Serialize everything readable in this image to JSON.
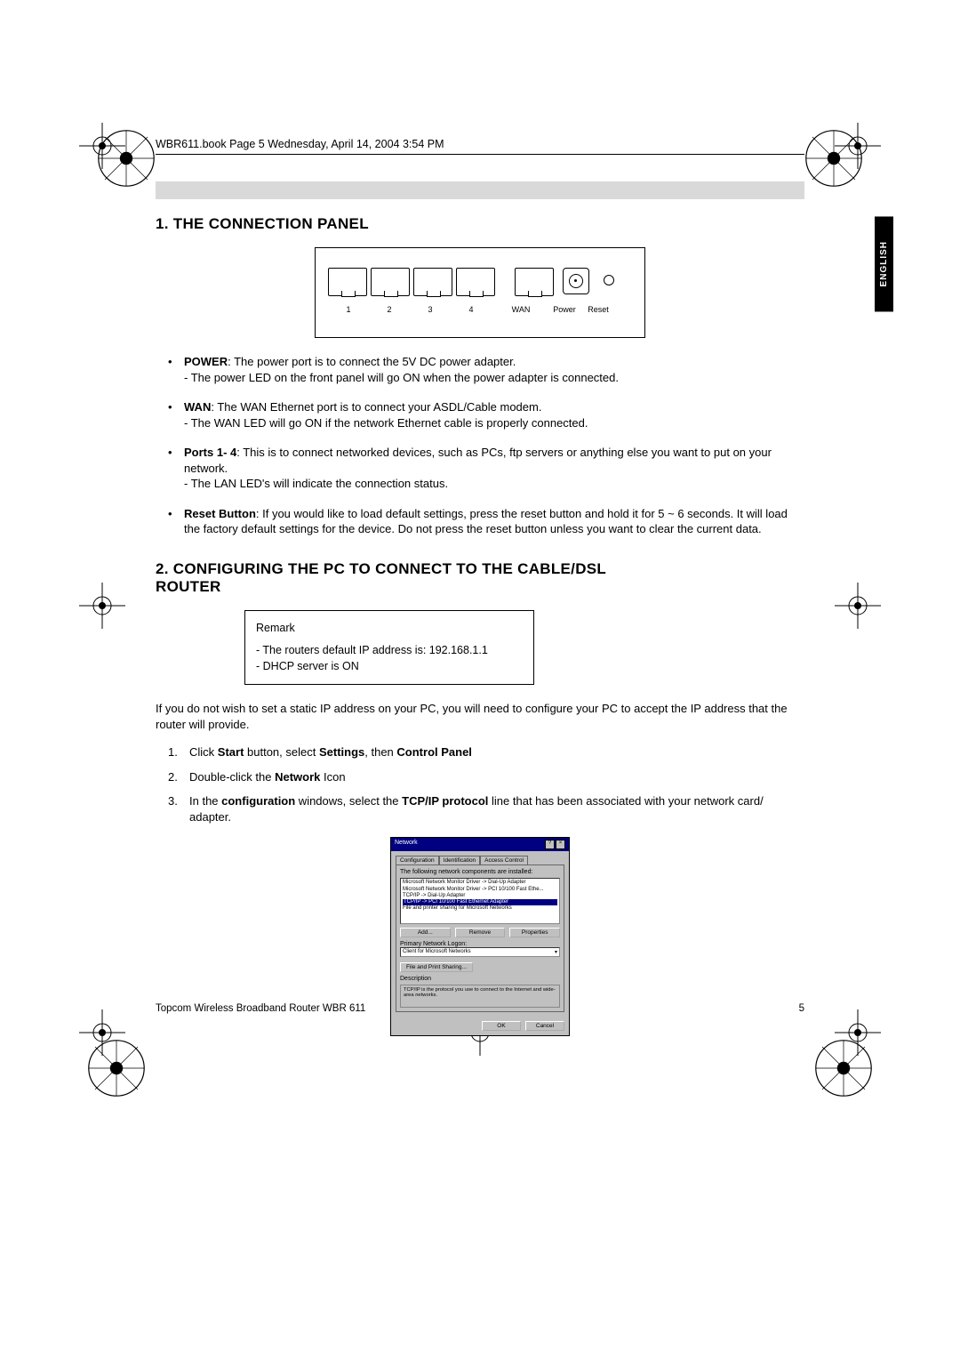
{
  "print_header": "WBR611.book  Page 5  Wednesday, April 14, 2004  3:54 PM",
  "lang_tab": "ENGLISH",
  "section1": {
    "title": "1. THE CONNECTION PANEL",
    "panel_labels": {
      "p1": "1",
      "p2": "2",
      "p3": "3",
      "p4": "4",
      "wan": "WAN",
      "power": "Power",
      "reset": "Reset"
    },
    "items": {
      "power_label": "POWER",
      "power_text": ": The power port is to connect the 5V DC power adapter.",
      "power_sub": "- The power LED on the front panel will go ON when the power adapter is connected.",
      "wan_label": "WAN",
      "wan_text": ": The WAN Ethernet port is to connect your ASDL/Cable modem.",
      "wan_sub": "- The WAN LED will go ON if the network Ethernet cable is properly connected.",
      "ports_label": "Ports 1- 4",
      "ports_text": ": This is to connect networked devices, such as PCs, ftp servers or anything else you want to put on your network.",
      "ports_sub": "- The LAN LED's will indicate the connection status.",
      "reset_label": "Reset Button",
      "reset_text": ": If you would like to load default settings, press the reset button and hold it for 5 ~ 6 seconds. It will load the factory default settings for the device. Do not press the reset button unless you want to clear the current data."
    }
  },
  "section2": {
    "title": "2. CONFIGURING THE PC TO CONNECT TO THE CABLE/DSL ROUTER",
    "remark_title": "Remark",
    "remark_line1": "- The routers default IP address is: 192.168.1.1",
    "remark_line2": "- DHCP server is ON",
    "para": "If you do not wish to set a static IP address on your PC, you will need to configure your PC to accept the IP address that the router will provide.",
    "steps": {
      "s1a": "Click ",
      "s1b": "Start",
      "s1c": " button, select ",
      "s1d": "Settings",
      "s1e": ", then ",
      "s1f": "Control Panel",
      "s2a": "Double-click the ",
      "s2b": "Network",
      "s2c": " Icon",
      "s3a": "In the ",
      "s3b": "configuration",
      "s3c": " windows, select the ",
      "s3d": "TCP/IP protocol",
      "s3e": " line that has been associated with your network card/ adapter."
    }
  },
  "dialog": {
    "title": "Network",
    "tabs": {
      "t1": "Configuration",
      "t2": "Identification",
      "t3": "Access Control"
    },
    "list_label": "The following network components are installed:",
    "list": {
      "i1": "Microsoft Network Monitor Driver -> Dial-Up Adapter",
      "i2": "Microsoft Network Monitor Driver -> PCI 10/100 Fast Ethe...",
      "i3": "TCP/IP -> Dial-Up Adapter",
      "i4": "TCP/IP -> PCI 10/100 Fast Ethernet Adapter",
      "i5": "File and printer sharing for Microsoft Networks"
    },
    "btns": {
      "add": "Add...",
      "remove": "Remove",
      "props": "Properties"
    },
    "logon_label": "Primary Network Logon:",
    "logon_value": "Client for Microsoft Networks",
    "share_btn": "File and Print Sharing...",
    "desc_label": "Description",
    "desc_text": "TCP/IP is the protocol you use to connect to the Internet and wide-area networks.",
    "ok": "OK",
    "cancel": "Cancel"
  },
  "footer": {
    "left": "Topcom Wireless Broadband Router WBR 611",
    "right": "5"
  }
}
